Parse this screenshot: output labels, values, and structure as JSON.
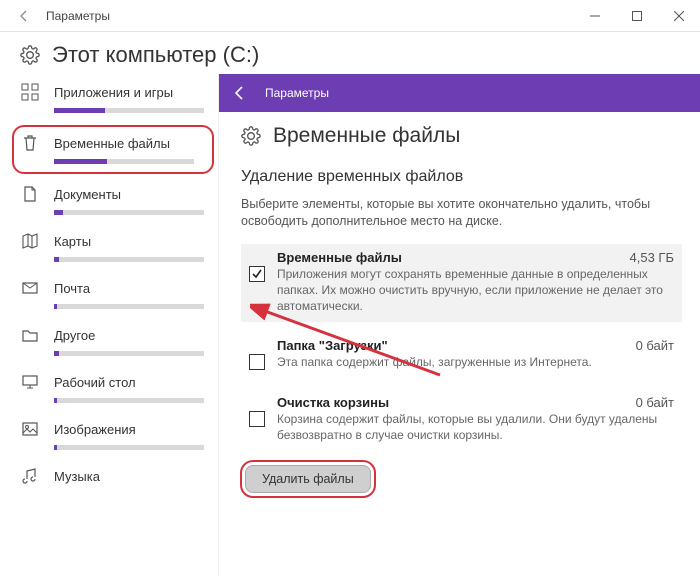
{
  "titlebar": {
    "back_tip": "Назад",
    "title": "Параметры",
    "min_tip": "Свернуть",
    "max_tip": "Развернуть",
    "close_tip": "Закрыть"
  },
  "page_head": {
    "title": "Этот компьютер (C:)"
  },
  "sidebar": [
    {
      "id": "apps",
      "label": "Приложения и игры",
      "fill": 34
    },
    {
      "id": "temp",
      "label": "Временные файлы",
      "fill": 38
    },
    {
      "id": "docs",
      "label": "Документы",
      "fill": 6
    },
    {
      "id": "maps",
      "label": "Карты",
      "fill": 3
    },
    {
      "id": "mail",
      "label": "Почта",
      "fill": 2
    },
    {
      "id": "other",
      "label": "Другое",
      "fill": 3
    },
    {
      "id": "desktop",
      "label": "Рабочий стол",
      "fill": 2
    },
    {
      "id": "images",
      "label": "Изображения",
      "fill": 2
    },
    {
      "id": "music",
      "label": "Музыка",
      "fill": 2
    }
  ],
  "breadcrumb": {
    "back_tip": "Назад",
    "label": "Параметры"
  },
  "content": {
    "title": "Временные файлы",
    "section_title": "Удаление временных файлов",
    "section_desc": "Выберите элементы, которые вы хотите окончательно удалить, чтобы освободить дополнительное место на диске."
  },
  "options": [
    {
      "name": "Временные файлы",
      "size": "4,53 ГБ",
      "desc": "Приложения могут сохранять временные данные в определенных папках. Их можно очистить вручную, если приложение не делает это автоматически.",
      "checked": true,
      "selected": true
    },
    {
      "name": "Папка \"Загрузки\"",
      "size": "0 байт",
      "desc": "Эта папка содержит файлы, загруженные из Интернета.",
      "checked": false,
      "selected": false
    },
    {
      "name": "Очистка корзины",
      "size": "0 байт",
      "desc": "Корзина содержит файлы, которые вы удалили. Они будут удалены безвозвратно в случае очистки корзины.",
      "checked": false,
      "selected": false
    }
  ],
  "button": {
    "label": "Удалить файлы"
  }
}
